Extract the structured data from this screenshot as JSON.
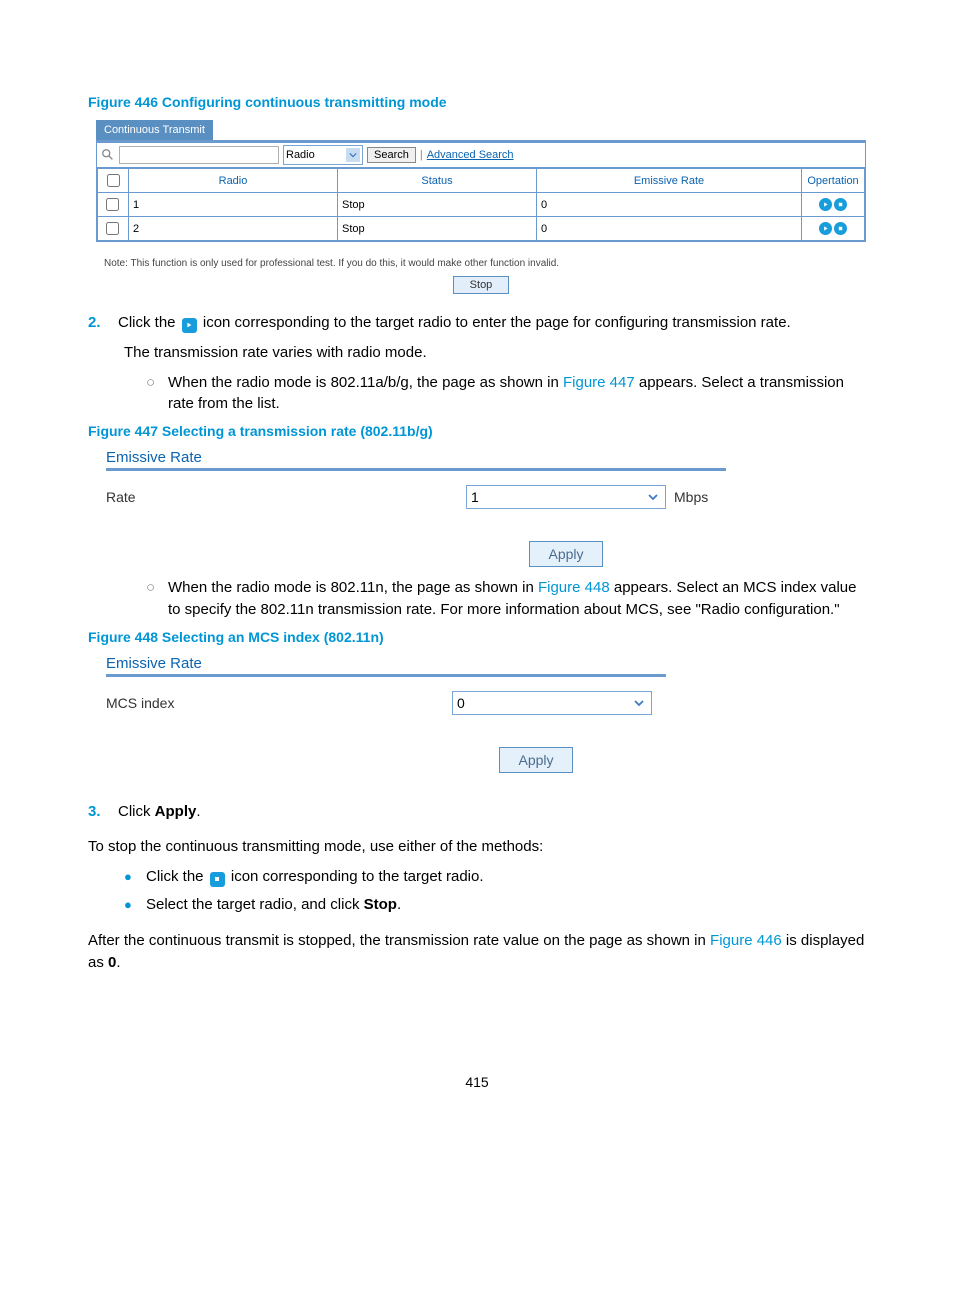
{
  "fig446": {
    "caption": "Figure 446 Configuring continuous transmitting mode",
    "tab": "Continuous Transmit",
    "search_select": "Radio",
    "search_btn": "Search",
    "adv_search": "Advanced Search",
    "headers": {
      "radio": "Radio",
      "status": "Status",
      "rate": "Emissive Rate",
      "op": "Opertation"
    },
    "rows": [
      {
        "radio": "1",
        "status": "Stop",
        "rate": "0"
      },
      {
        "radio": "2",
        "status": "Stop",
        "rate": "0"
      }
    ],
    "note": "Note: This function is only used for professional test. If you do this, it would make other function invalid.",
    "stop_btn": "Stop"
  },
  "step2": {
    "num": "2.",
    "line1a": "Click the ",
    "line1b": " icon corresponding to the target radio to enter the page for configuring transmission rate.",
    "line2": "The transmission rate varies with radio mode.",
    "sub_a_1": "When the radio mode is 802.11a/b/g, the page as shown in ",
    "sub_a_link": "Figure 447",
    "sub_a_2": " appears. Select a transmission rate from the list."
  },
  "fig447": {
    "caption": "Figure 447 Selecting a transmission rate (802.11b/g)",
    "title": "Emissive Rate",
    "label": "Rate",
    "value": "1",
    "unit": "Mbps",
    "apply": "Apply"
  },
  "sub_b": {
    "t1": "When the radio mode is 802.11n, the page as shown in ",
    "link": "Figure 448",
    "t2": " appears. Select an MCS index value to specify the 802.11n transmission rate. For more information about MCS, see \"Radio configuration.\""
  },
  "fig448": {
    "caption": "Figure 448 Selecting an MCS index (802.11n)",
    "title": "Emissive Rate",
    "label": "MCS index",
    "value": "0",
    "apply": "Apply"
  },
  "step3": {
    "num": "3.",
    "pre": "Click ",
    "bold": "Apply",
    "post": "."
  },
  "closing": {
    "intro": "To stop the continuous transmitting mode, use either of the methods:",
    "b1a": "Click the ",
    "b1b": " icon corresponding to the target radio.",
    "b2a": "Select the target radio, and click ",
    "b2bold": "Stop",
    "b2b": ".",
    "after1": "After the continuous transmit is stopped, the transmission rate value on the page as shown in ",
    "after_link": "Figure 446",
    "after2": " is displayed as ",
    "after_bold": "0",
    "after3": "."
  },
  "page_number": "415"
}
